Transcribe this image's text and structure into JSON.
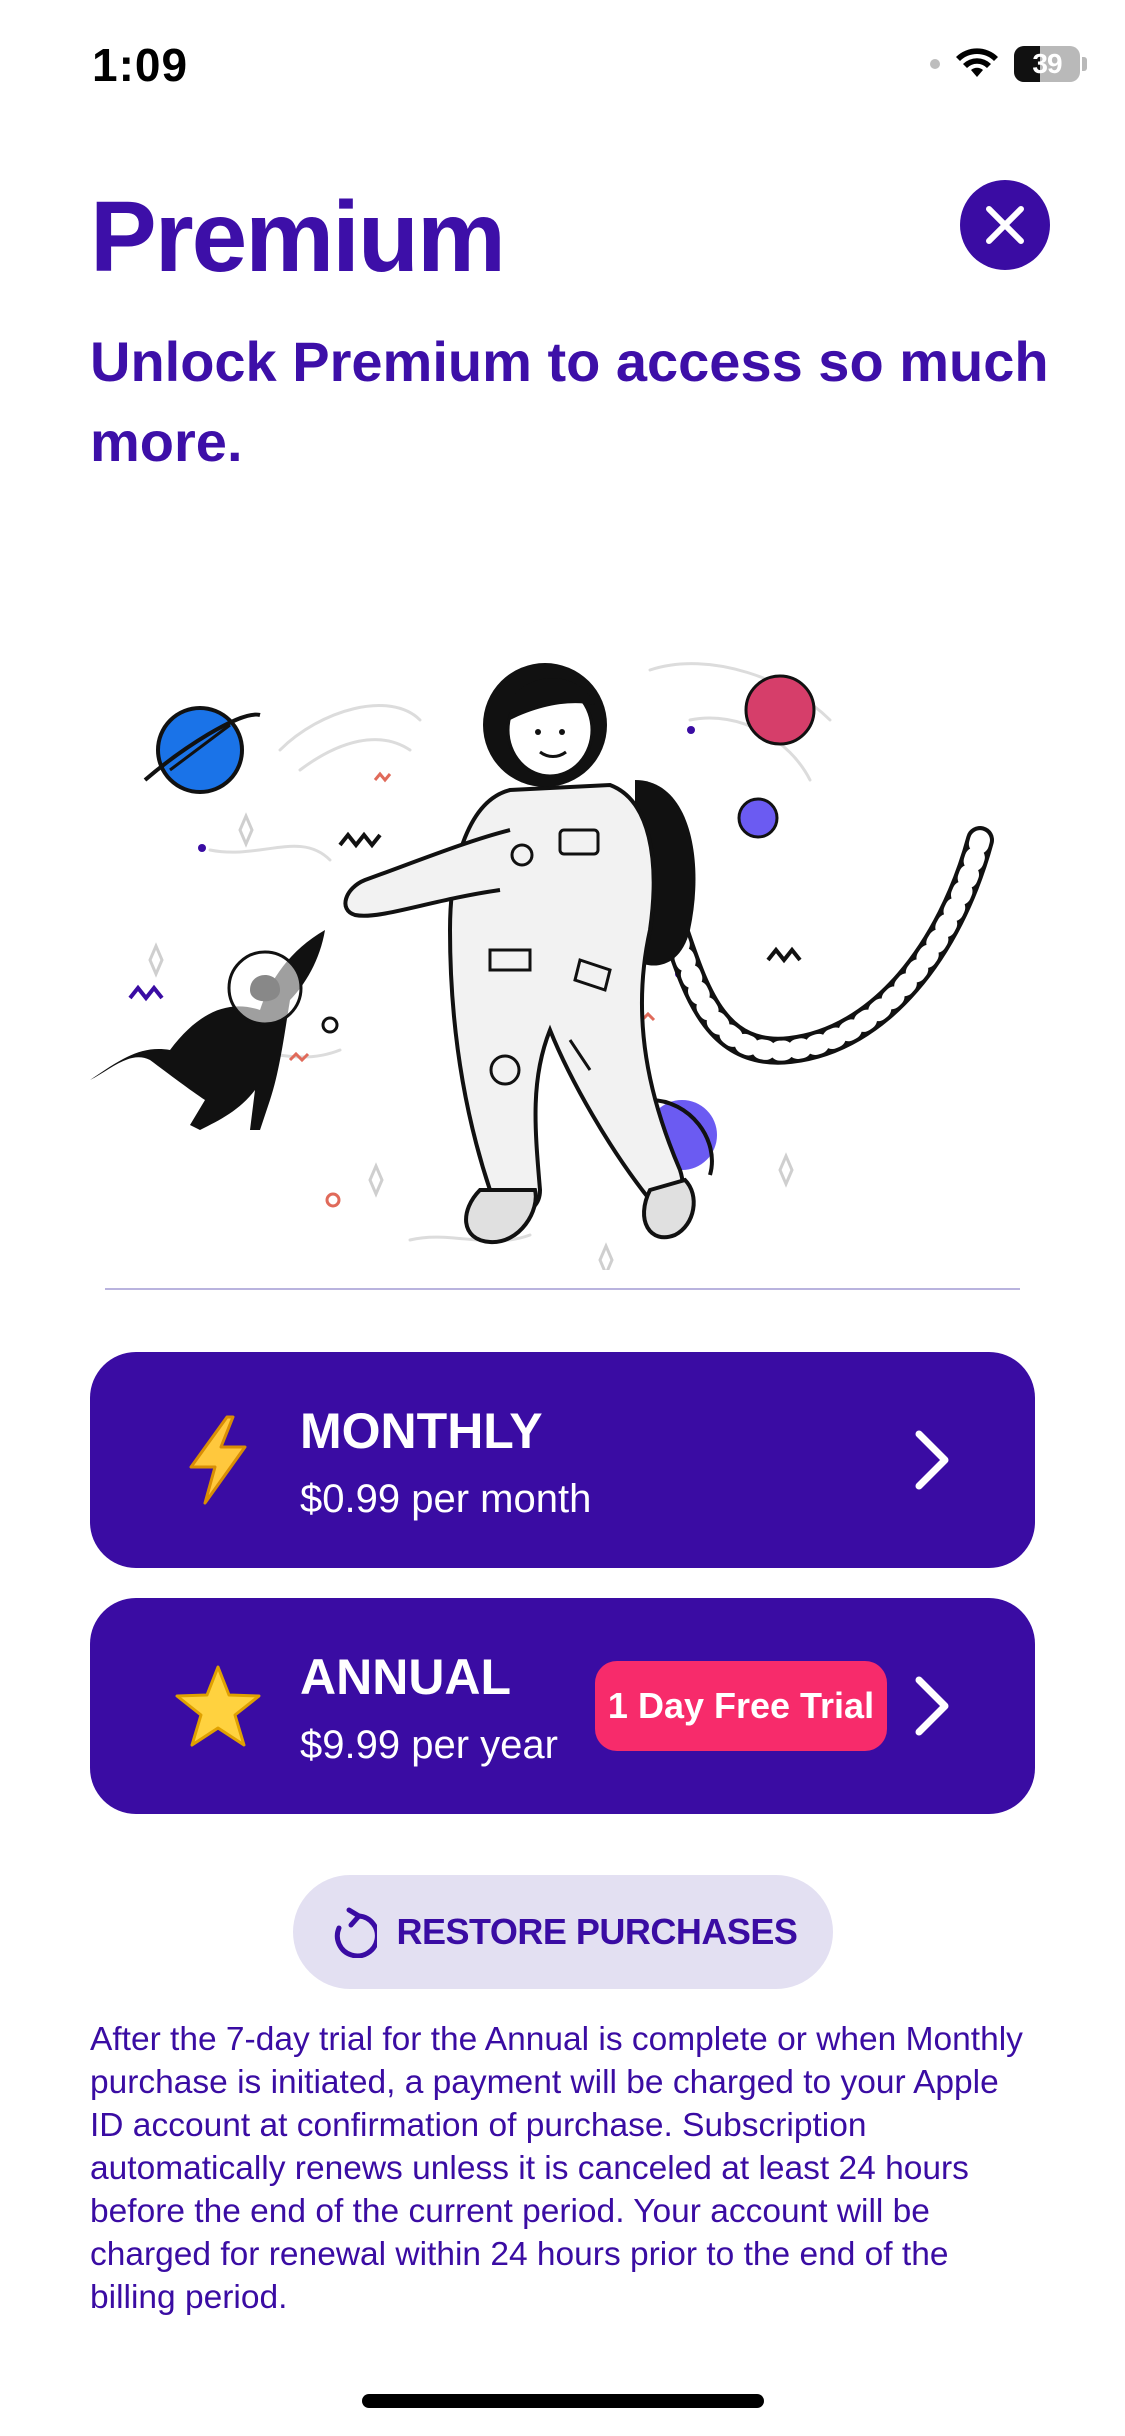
{
  "status_bar": {
    "time": "1:09",
    "battery": "39",
    "battery_level": 0.39
  },
  "header": {
    "title": "Premium",
    "subtitle": "Unlock Premium to access so much more."
  },
  "illustration": {
    "icon": "astronaut-cat-space-illustration"
  },
  "plans": [
    {
      "name": "MONTHLY",
      "price": "$0.99 per month",
      "icon": "lightning-icon"
    },
    {
      "name": "ANNUAL",
      "price": "$9.99 per year",
      "icon": "star-icon",
      "badge": "1 Day Free Trial"
    }
  ],
  "restore": {
    "label": "RESTORE PURCHASES",
    "icon": "restore-icon"
  },
  "legal_text": "After the 7-day trial for the Annual is complete or when Monthly purchase is initiated, a payment will be charged to your Apple ID account at confirmation of purchase. Subscription automatically renews unless it is canceled at least 24 hours before the end of the current period. Your account will be charged for renewal within 24 hours prior to the end of the billing period.",
  "colors": {
    "brand": "#3a0ca3",
    "accent": "#f72b6b",
    "restore_bg": "#e3e0f2"
  }
}
